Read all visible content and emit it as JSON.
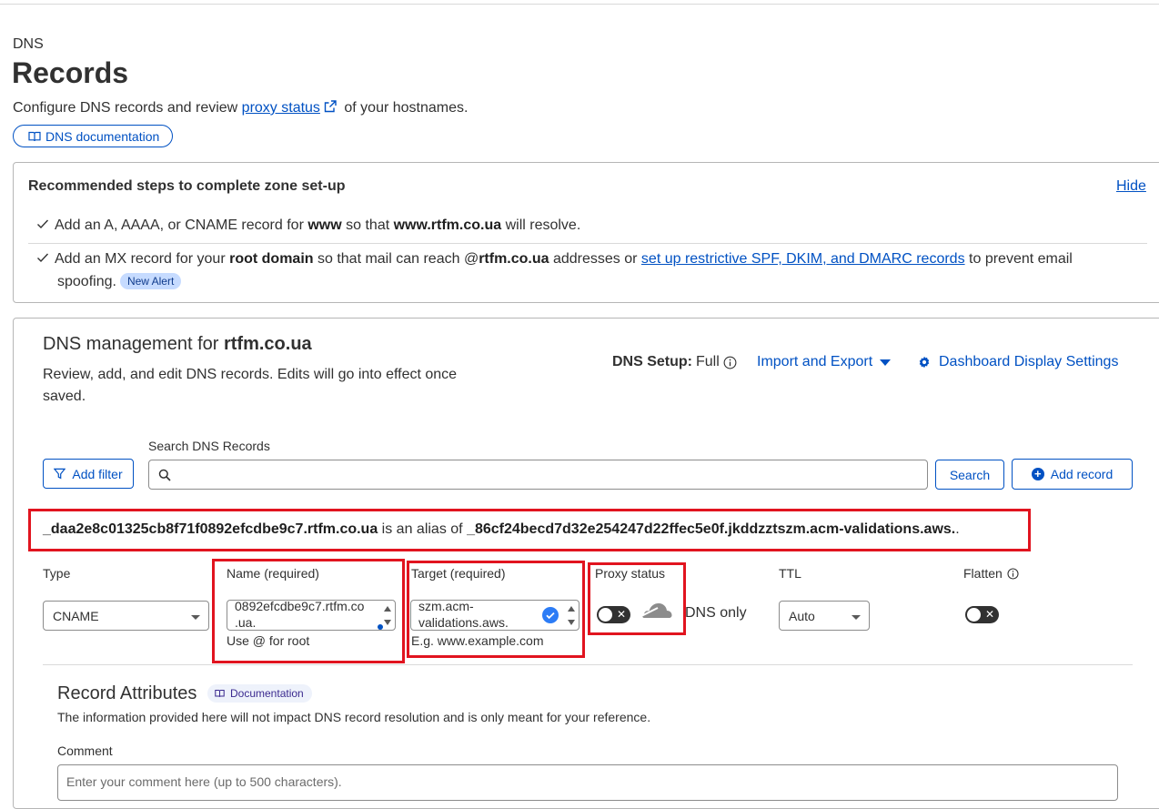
{
  "header": {
    "breadcrumb": "DNS",
    "title": "Records",
    "desc_before": "Configure DNS records and review ",
    "desc_link": "proxy status",
    "desc_after": " of your hostnames.",
    "doc_button": "DNS documentation"
  },
  "setup_panel": {
    "title": "Recommended steps to complete zone set-up",
    "hide": "Hide",
    "step1": {
      "a": "Add an A, AAAA, or CNAME record for ",
      "b": "www",
      "c": " so that ",
      "d": "www.rtfm.co.ua",
      "e": " will resolve."
    },
    "step2": {
      "a": "Add an MX record for your ",
      "b": "root domain",
      "c": " so that mail can reach @",
      "d": "rtfm.co.ua",
      "e": " addresses or ",
      "link": "set up restrictive SPF, DKIM, and DMARC records",
      "f": " to prevent email",
      "g": "spoofing.",
      "badge": "New Alert"
    }
  },
  "management": {
    "title_prefix": "DNS management for ",
    "domain": "rtfm.co.ua",
    "desc": "Review, add, and edit DNS records. Edits will go into effect once saved.",
    "dns_setup_label": "DNS Setup:",
    "dns_setup_value": "Full",
    "import_export": "Import and Export",
    "display_settings": "Dashboard Display Settings",
    "add_filter": "Add filter",
    "search_label": "Search DNS Records",
    "search_placeholder": "",
    "search_button": "Search",
    "add_record": "Add record"
  },
  "record": {
    "alias_name": "_daa2e8c01325cb8f71f0892efcdbe9c7.rtfm.co.ua",
    "alias_mid": " is an alias of ",
    "alias_target": "_86cf24becd7d32e254247d22ffec5e0f.jkddzztszm.acm-validations.aws.",
    "alias_tail": ".",
    "labels": {
      "type": "Type",
      "name": "Name (required)",
      "target": "Target (required)",
      "proxy": "Proxy status",
      "ttl": "TTL",
      "flatten": "Flatten"
    },
    "type_value": "CNAME",
    "name_line1": "0892efcdbe9c7.rtfm.co",
    "name_line2": ".ua.",
    "name_helper": "Use @ for root",
    "target_line1": "szm.acm-",
    "target_line2": "validations.aws.",
    "target_helper": "E.g. www.example.com",
    "proxy_text": "DNS only",
    "ttl_value": "Auto"
  },
  "attributes": {
    "title": "Record Attributes",
    "doc_badge": "Documentation",
    "desc": "The information provided here will not impact DNS record resolution and is only meant for your reference.",
    "comment_label": "Comment",
    "comment_placeholder": "Enter your comment here (up to 500 characters)."
  }
}
